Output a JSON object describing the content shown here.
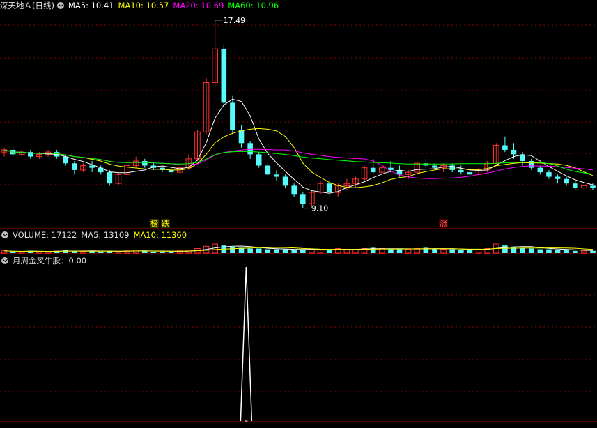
{
  "colors": {
    "up": "#ff3030",
    "down": "#54fcfc",
    "ma5": "#ffffff",
    "ma10": "#ffff00",
    "ma20": "#ff00ff",
    "ma60": "#00ff00",
    "grid": "#8b0000",
    "text_red": "#ff4040"
  },
  "main_panel": {
    "title": "深天地Ａ(日线)",
    "ma5": "MA5: 10.41",
    "ma10": "MA10: 10.57",
    "ma20": "MA20: 10.69",
    "ma60": "MA60: 10.96",
    "high_label": "17.49",
    "low_label": "9.10",
    "marker_1": "榜",
    "marker_2": "跌",
    "marker_3": "涨"
  },
  "volume_panel": {
    "volume": "VOLUME: 17122",
    "ma5": "MA5: 13109",
    "ma10": "MA10: 11360"
  },
  "indicator_panel": {
    "label": "月周金叉牛股：0.00"
  },
  "chart_data": [
    {
      "type": "candlestick",
      "title": "深天地Ａ(日线)",
      "y_range": [
        9.1,
        17.49
      ],
      "high": 17.49,
      "low": 9.1,
      "candles": [
        [
          11.6,
          11.8,
          11.4,
          11.7
        ],
        [
          11.7,
          11.8,
          11.4,
          11.5
        ],
        [
          11.5,
          11.7,
          11.4,
          11.6
        ],
        [
          11.6,
          11.7,
          11.3,
          11.4
        ],
        [
          11.4,
          11.6,
          11.3,
          11.5
        ],
        [
          11.5,
          11.7,
          11.4,
          11.6
        ],
        [
          11.6,
          11.7,
          11.3,
          11.4
        ],
        [
          11.4,
          11.5,
          11.0,
          11.1
        ],
        [
          11.1,
          11.2,
          10.6,
          10.8
        ],
        [
          10.8,
          11.1,
          10.7,
          11.0
        ],
        [
          11.0,
          11.2,
          10.7,
          10.9
        ],
        [
          10.9,
          11.0,
          10.6,
          10.7
        ],
        [
          10.7,
          10.8,
          10.1,
          10.2
        ],
        [
          10.2,
          10.7,
          10.1,
          10.6
        ],
        [
          10.6,
          11.1,
          10.5,
          11.0
        ],
        [
          11.0,
          11.4,
          10.9,
          11.2
        ],
        [
          11.2,
          11.3,
          10.9,
          11.0
        ],
        [
          11.0,
          11.1,
          10.8,
          10.9
        ],
        [
          10.9,
          11.0,
          10.7,
          10.8
        ],
        [
          10.8,
          10.9,
          10.6,
          10.7
        ],
        [
          10.7,
          11.0,
          10.6,
          10.9
        ],
        [
          10.9,
          11.5,
          10.8,
          11.3
        ],
        [
          11.3,
          12.6,
          11.2,
          12.5
        ],
        [
          12.5,
          14.9,
          12.4,
          14.7
        ],
        [
          14.7,
          17.49,
          14.5,
          16.2
        ],
        [
          16.2,
          16.4,
          13.6,
          13.8
        ],
        [
          13.8,
          14.1,
          12.4,
          12.6
        ],
        [
          12.6,
          12.8,
          11.8,
          12.0
        ],
        [
          12.0,
          12.1,
          11.3,
          11.5
        ],
        [
          11.5,
          11.6,
          10.9,
          11.0
        ],
        [
          11.0,
          11.1,
          10.5,
          10.6
        ],
        [
          10.6,
          10.8,
          10.3,
          10.5
        ],
        [
          10.5,
          10.6,
          10.0,
          10.1
        ],
        [
          10.1,
          10.2,
          9.6,
          9.7
        ],
        [
          9.7,
          9.8,
          9.1,
          9.3
        ],
        [
          9.3,
          9.9,
          9.2,
          9.8
        ],
        [
          9.8,
          10.3,
          9.7,
          10.2
        ],
        [
          10.2,
          10.4,
          9.6,
          9.8
        ],
        [
          9.8,
          10.2,
          9.6,
          10.1
        ],
        [
          10.1,
          10.4,
          9.9,
          10.2
        ],
        [
          10.2,
          10.5,
          10.0,
          10.4
        ],
        [
          10.4,
          11.0,
          10.3,
          10.9
        ],
        [
          10.9,
          11.3,
          10.6,
          10.7
        ],
        [
          10.7,
          11.0,
          10.6,
          10.9
        ],
        [
          10.9,
          11.2,
          10.7,
          10.8
        ],
        [
          10.8,
          11.0,
          10.5,
          10.6
        ],
        [
          10.6,
          10.8,
          10.4,
          10.7
        ],
        [
          10.7,
          11.2,
          10.6,
          11.1
        ],
        [
          11.1,
          11.3,
          10.9,
          11.0
        ],
        [
          11.0,
          11.1,
          10.8,
          10.9
        ],
        [
          10.9,
          11.1,
          10.7,
          11.0
        ],
        [
          11.0,
          11.1,
          10.7,
          10.8
        ],
        [
          10.8,
          11.0,
          10.6,
          10.7
        ],
        [
          10.7,
          10.8,
          10.5,
          10.6
        ],
        [
          10.6,
          10.9,
          10.5,
          10.8
        ],
        [
          10.8,
          11.2,
          10.7,
          11.1
        ],
        [
          11.1,
          12.0,
          11.0,
          11.9
        ],
        [
          11.9,
          12.3,
          11.6,
          11.7
        ],
        [
          11.7,
          12.0,
          11.3,
          11.5
        ],
        [
          11.5,
          11.6,
          11.0,
          11.2
        ],
        [
          11.2,
          11.3,
          10.8,
          10.9
        ],
        [
          10.9,
          11.0,
          10.6,
          10.7
        ],
        [
          10.7,
          10.8,
          10.4,
          10.5
        ],
        [
          10.5,
          10.6,
          10.2,
          10.4
        ],
        [
          10.4,
          10.5,
          10.1,
          10.2
        ],
        [
          10.2,
          10.3,
          9.9,
          10.0
        ],
        [
          10.0,
          10.2,
          9.9,
          10.1
        ],
        [
          10.1,
          10.2,
          9.9,
          10.0
        ]
      ]
    },
    {
      "type": "bar",
      "title": "VOLUME",
      "values": [
        3,
        2,
        2,
        3,
        2,
        2,
        3,
        4,
        3,
        2,
        3,
        2,
        3,
        2,
        3,
        4,
        3,
        2,
        2,
        2,
        3,
        4,
        6,
        9,
        12,
        10,
        8,
        7,
        6,
        6,
        5,
        5,
        5,
        4,
        5,
        5,
        4,
        5,
        6,
        5,
        5,
        6,
        7,
        6,
        5,
        5,
        5,
        6,
        7,
        6,
        5,
        5,
        4,
        4,
        5,
        6,
        12,
        10,
        8,
        7,
        6,
        5,
        5,
        4,
        4,
        3,
        3,
        3
      ]
    },
    {
      "type": "line",
      "title": "月周金叉牛股",
      "peak_index": 0.41,
      "values": [
        0,
        1,
        0
      ]
    }
  ]
}
